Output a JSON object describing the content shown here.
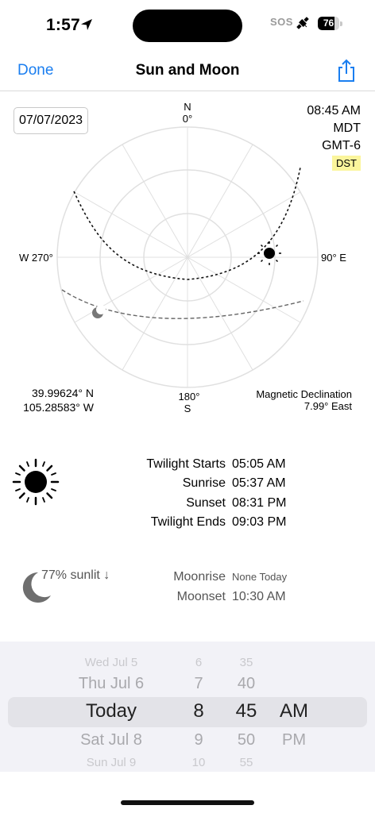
{
  "status_bar": {
    "time": "1:57",
    "sos": "SOS",
    "battery": "76",
    "battery_level": 0.76
  },
  "nav": {
    "done_label": "Done",
    "title": "Sun and Moon",
    "share_icon": "share-icon"
  },
  "chart": {
    "date": "07/07/2023",
    "time": "08:45 AM",
    "timezone": "MDT",
    "gmt_offset": "GMT-6",
    "dst_badge": "DST",
    "north_letter": "N",
    "north_deg": "0°",
    "south_deg": "180°",
    "south_letter": "S",
    "west": "W 270°",
    "east": "90° E",
    "latitude": "39.99624° N",
    "longitude": "105.28583° W",
    "mag_dec_label": "Magnetic Declination",
    "mag_dec_value": "7.99° East"
  },
  "sun": {
    "icon": "sun-icon",
    "events": [
      {
        "label": "Twilight Starts",
        "time": "05:05 AM"
      },
      {
        "label": "Sunrise",
        "time": "05:37 AM"
      },
      {
        "label": "Sunset",
        "time": "08:31 PM"
      },
      {
        "label": "Twilight Ends",
        "time": "09:03 PM"
      }
    ]
  },
  "moon": {
    "icon": "moon-icon",
    "sunlit": "77% sunlit ↓",
    "moonrise_label": "Moonrise",
    "moonrise": "None Today",
    "moonset_label": "Moonset",
    "moonset": "10:30 AM"
  },
  "picker": {
    "dates": [
      "Wed Jul 5",
      "Thu Jul 6",
      "Today",
      "Sat Jul 8",
      "Sun Jul 9"
    ],
    "hours": [
      "6",
      "7",
      "8",
      "9",
      "10"
    ],
    "minutes": [
      "35",
      "40",
      "45",
      "50",
      "55"
    ],
    "ampm": [
      "",
      "",
      "AM",
      "PM",
      ""
    ]
  },
  "colors": {
    "accent": "#1a7ef0",
    "dst_highlight": "#fbf59c",
    "picker_bg": "#f2f2f7"
  }
}
